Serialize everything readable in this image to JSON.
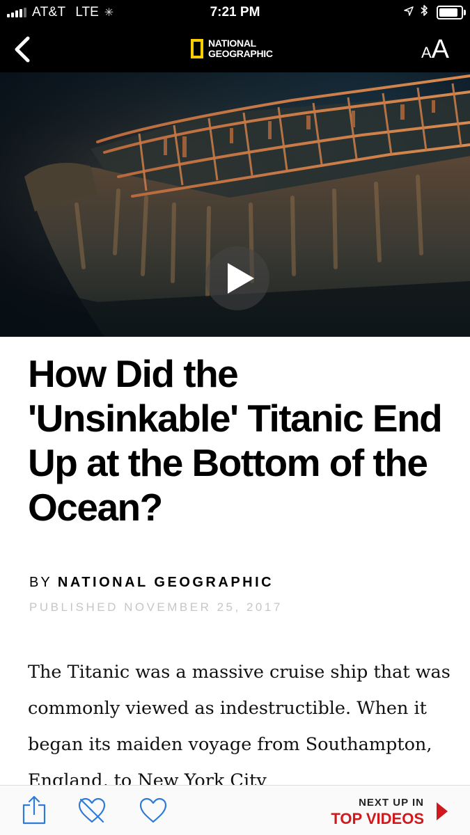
{
  "status_bar": {
    "carrier": "AT&T",
    "network": "LTE",
    "time": "7:21 PM"
  },
  "nav": {
    "logo_line1": "NATIONAL",
    "logo_line2": "GEOGRAPHIC",
    "text_size_small": "A",
    "text_size_large": "A",
    "icons": [
      "back-chevron-icon",
      "text-size-icon"
    ]
  },
  "video": {
    "icons": [
      "play-icon"
    ]
  },
  "article": {
    "headline": "How Did the 'Unsinkable' Titanic End Up at the Bottom of the Ocean?",
    "byline_prefix": "BY",
    "author": "NATIONAL GEOGRAPHIC",
    "published": "PUBLISHED NOVEMBER 25, 2017",
    "body": "The Titanic was a massive cruise ship that was commonly viewed as indestructible. When it began its maiden voyage from Southampton, England, to New York City"
  },
  "toolbar": {
    "next_up_label": "NEXT UP IN",
    "next_up_destination": "TOP VIDEOS",
    "icons": [
      "share-icon",
      "dislike-heart-icon",
      "like-heart-icon",
      "next-arrow-icon"
    ],
    "accent_color": "#d0191c"
  },
  "colors": {
    "brand_yellow": "#FFCE00",
    "header_background": "#000000"
  }
}
